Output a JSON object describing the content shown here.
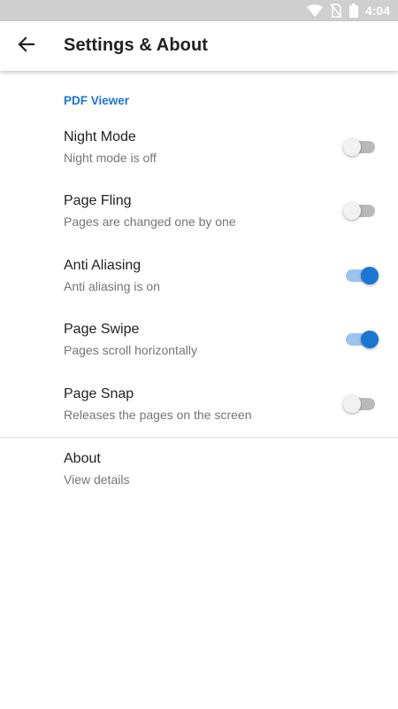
{
  "status_bar": {
    "time": "4:04",
    "icons": [
      "wifi-icon",
      "no-sim-icon",
      "battery-icon"
    ]
  },
  "app_bar": {
    "back_icon": "arrow-left-icon",
    "title": "Settings & About"
  },
  "sections": {
    "pdf_viewer": {
      "header": "PDF Viewer",
      "items": [
        {
          "title": "Night Mode",
          "summary": "Night mode is off",
          "enabled": false
        },
        {
          "title": "Page Fling",
          "summary": "Pages are changed one by one",
          "enabled": false
        },
        {
          "title": "Anti Aliasing",
          "summary": "Anti aliasing is on",
          "enabled": true
        },
        {
          "title": "Page Swipe",
          "summary": "Pages scroll horizontally",
          "enabled": true
        },
        {
          "title": "Page Snap",
          "summary": "Releases the pages on the screen",
          "enabled": false
        }
      ]
    },
    "about": {
      "title": "About",
      "summary": "View details"
    }
  },
  "colors": {
    "accent": "#1976d2",
    "status_bar": "#cfcfcf",
    "switch_off_track": "#b9b9b9",
    "switch_on_track": "#9dc3ef"
  }
}
